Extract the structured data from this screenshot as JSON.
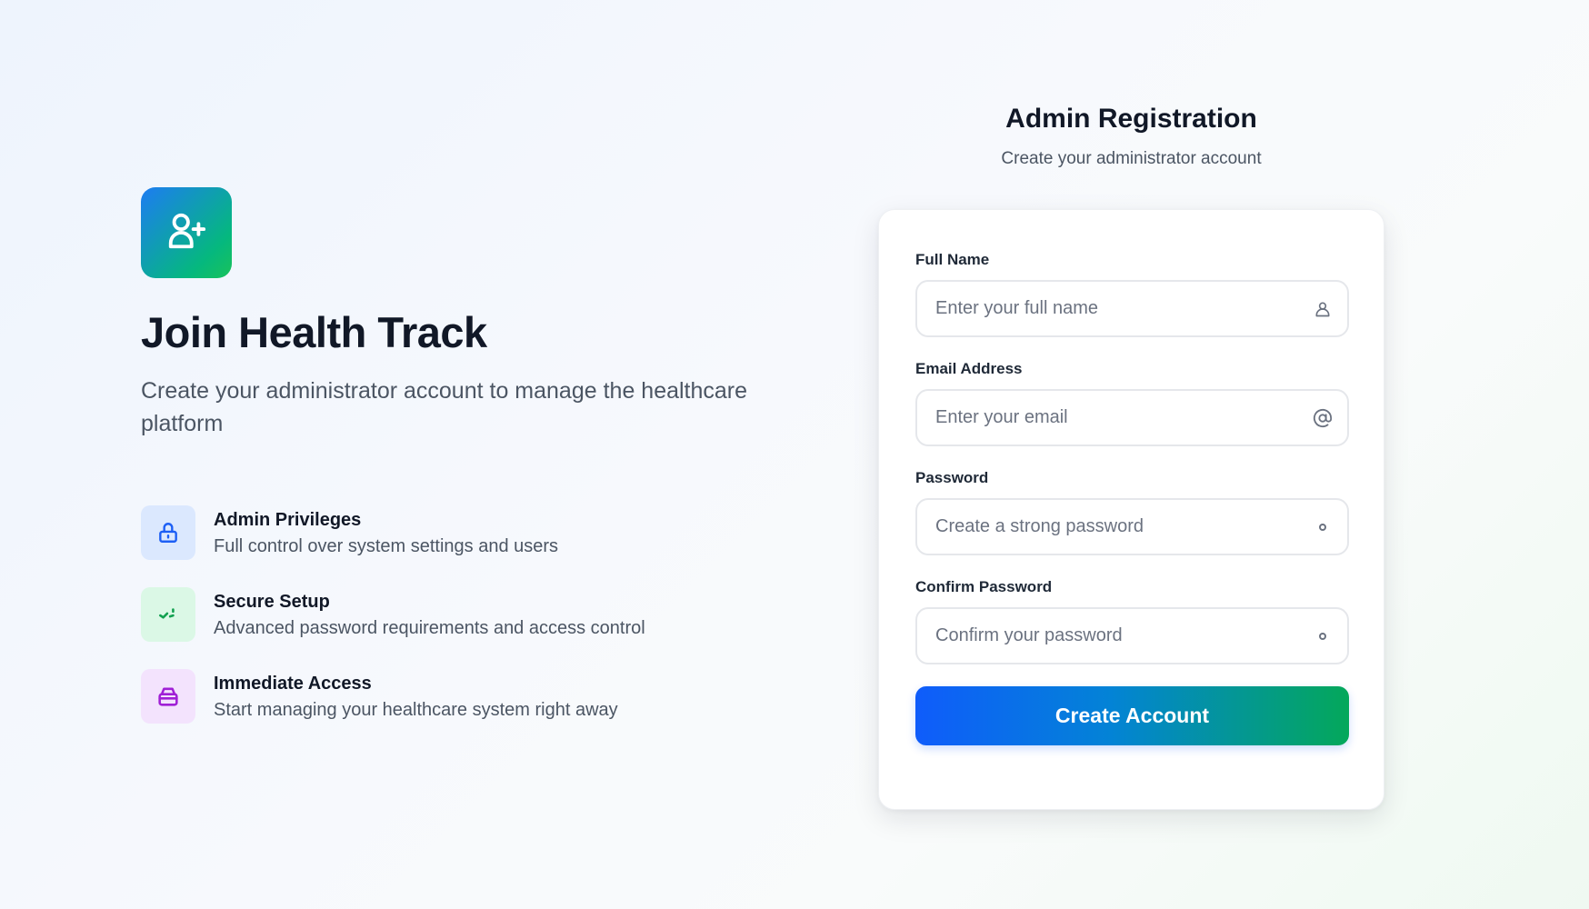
{
  "hero": {
    "logo_icon": "user-plus-icon",
    "title": "Join Health Track",
    "subtitle": "Create your administrator account to manage the healthcare platform",
    "features": [
      {
        "icon": "lock-icon",
        "color": "#1d5ff5",
        "title": "Admin Privileges",
        "description": "Full control over system settings and users"
      },
      {
        "icon": "check-icon",
        "color": "#12a150",
        "title": "Secure Setup",
        "description": "Advanced password requirements and access control"
      },
      {
        "icon": "inbox-icon",
        "color": "#a020d6",
        "title": "Immediate Access",
        "description": "Start managing your healthcare system right away"
      }
    ]
  },
  "form": {
    "title": "Admin Registration",
    "subtitle": "Create your administrator account",
    "fields": [
      {
        "label": "Full Name",
        "placeholder": "Enter your full name",
        "value": "",
        "icon": "user-icon"
      },
      {
        "label": "Email Address",
        "placeholder": "Enter your email",
        "value": "",
        "icon": "at-icon"
      },
      {
        "label": "Password",
        "placeholder": "Create a strong password",
        "value": "",
        "icon": "dot-icon"
      },
      {
        "label": "Confirm Password",
        "placeholder": "Confirm your password",
        "value": "",
        "icon": "dot-icon"
      }
    ],
    "submit_label": "Create Account"
  },
  "colors": {
    "brand_gradient_start": "#0f5cfb",
    "brand_gradient_end": "#04a85a",
    "text_primary": "#111827",
    "text_secondary": "#4b5563"
  }
}
